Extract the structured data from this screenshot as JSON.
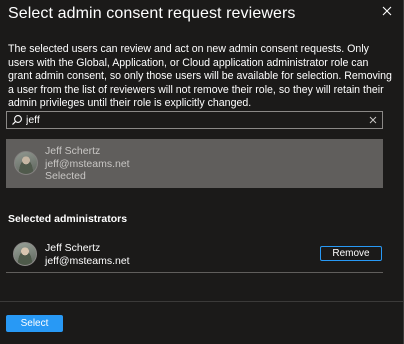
{
  "dialog": {
    "title": "Select admin consent request reviewers",
    "description": "The selected users can review and act on new admin consent requests. Only users with the Global, Application, or Cloud application administrator role can grant admin consent, so only those users will be available for selection. Removing a user from the list of reviewers will not remove their role, so they will retain their admin privileges until their role is explicitly changed."
  },
  "search": {
    "value": "jeff",
    "icon": "search-icon",
    "clear_icon": "close-icon"
  },
  "results": [
    {
      "name": "Jeff Schertz",
      "email": "jeff@msteams.net",
      "status": "Selected"
    }
  ],
  "selected_section": {
    "title": "Selected administrators",
    "items": [
      {
        "name": "Jeff Schertz",
        "email": "jeff@msteams.net",
        "action_label": "Remove"
      }
    ]
  },
  "footer": {
    "select_label": "Select"
  },
  "colors": {
    "background": "#1b1a19",
    "accent": "#2899f5",
    "result_highlight": "#605e5c"
  }
}
